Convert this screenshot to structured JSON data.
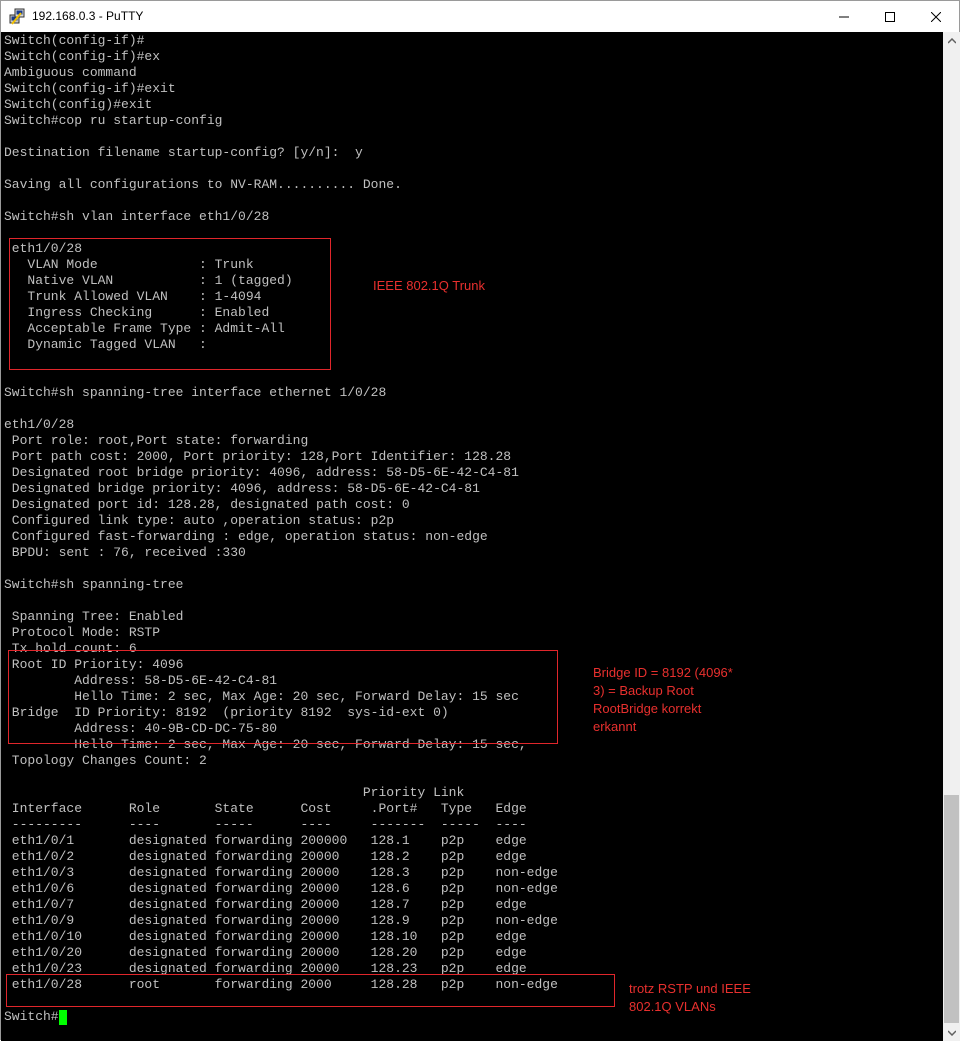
{
  "window": {
    "title": "192.168.0.3 - PuTTY"
  },
  "terminal": {
    "lines": [
      "Switch(config-if)#",
      "Switch(config-if)#ex",
      "Ambiguous command",
      "Switch(config-if)#exit",
      "Switch(config)#exit",
      "Switch#cop ru startup-config",
      "",
      "Destination filename startup-config? [y/n]:  y",
      "",
      "Saving all configurations to NV-RAM.......... Done.",
      "",
      "Switch#sh vlan interface eth1/0/28",
      "",
      " eth1/0/28",
      "   VLAN Mode             : Trunk",
      "   Native VLAN           : 1 (tagged)",
      "   Trunk Allowed VLAN    : 1-4094",
      "   Ingress Checking      : Enabled",
      "   Acceptable Frame Type : Admit-All",
      "   Dynamic Tagged VLAN   :",
      "",
      "",
      "Switch#sh spanning-tree interface ethernet 1/0/28",
      "",
      "eth1/0/28",
      " Port role: root,Port state: forwarding",
      " Port path cost: 2000, Port priority: 128,Port Identifier: 128.28",
      " Designated root bridge priority: 4096, address: 58-D5-6E-42-C4-81",
      " Designated bridge priority: 4096, address: 58-D5-6E-42-C4-81",
      " Designated port id: 128.28, designated path cost: 0",
      " Configured link type: auto ,operation status: p2p",
      " Configured fast-forwarding : edge, operation status: non-edge",
      " BPDU: sent : 76, received :330",
      "",
      "Switch#sh spanning-tree",
      "",
      " Spanning Tree: Enabled",
      " Protocol Mode: RSTP",
      " Tx hold count: 6",
      " Root ID Priority: 4096",
      "         Address: 58-D5-6E-42-C4-81",
      "         Hello Time: 2 sec, Max Age: 20 sec, Forward Delay: 15 sec",
      " Bridge  ID Priority: 8192  (priority 8192  sys-id-ext 0)",
      "         Address: 40-9B-CD-DC-75-80",
      "         Hello Time: 2 sec, Max Age: 20 sec, Forward Delay: 15 sec,",
      " Topology Changes Count: 2",
      "",
      "                                              Priority Link",
      " Interface      Role       State      Cost     .Port#   Type   Edge",
      " ---------      ----       -----      ----     -------  -----  ----",
      " eth1/0/1       designated forwarding 200000   128.1    p2p    edge",
      " eth1/0/2       designated forwarding 20000    128.2    p2p    edge",
      " eth1/0/3       designated forwarding 20000    128.3    p2p    non-edge",
      " eth1/0/6       designated forwarding 20000    128.6    p2p    non-edge",
      " eth1/0/7       designated forwarding 20000    128.7    p2p    edge",
      " eth1/0/9       designated forwarding 20000    128.9    p2p    non-edge",
      " eth1/0/10      designated forwarding 20000    128.10   p2p    edge",
      " eth1/0/20      designated forwarding 20000    128.20   p2p    edge",
      " eth1/0/23      designated forwarding 20000    128.23   p2p    edge",
      " eth1/0/28      root       forwarding 2000     128.28   p2p    non-edge",
      "",
      "Switch#"
    ]
  },
  "annotations": {
    "trunk_note": [
      "IEEE 802.1Q Trunk"
    ],
    "bridge_note": [
      "Bridge ID = 8192 (4096*",
      "3) = Backup Root",
      "RootBridge korrekt",
      "erkannt"
    ],
    "rstp_note": [
      "trotz RSTP und IEEE",
      "802.1Q VLANs"
    ]
  },
  "colors": {
    "terminal_bg": "#000000",
    "terminal_fg": "#c0c0c0",
    "cursor": "#00ff00",
    "annotation": "#e0262b"
  },
  "icons": {
    "app": "putty-icon",
    "minimize": "minimize-icon",
    "maximize": "maximize-icon",
    "close": "close-icon",
    "scroll_up": "scroll-up-arrow-icon",
    "scroll_down": "scroll-down-arrow-icon"
  }
}
